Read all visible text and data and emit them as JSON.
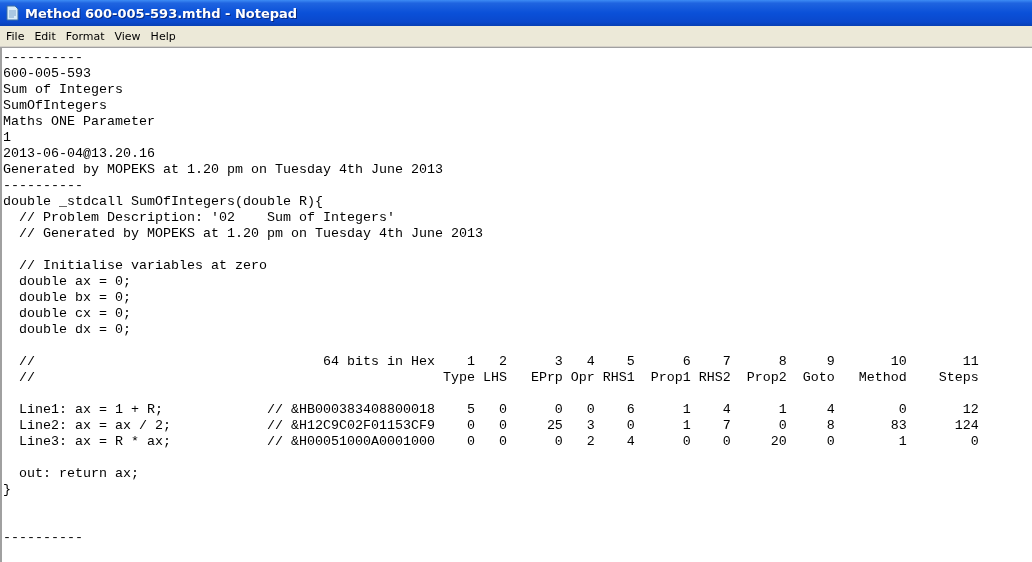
{
  "window": {
    "title": "Method 600-005-593.mthd - Notepad"
  },
  "menu": [
    "File",
    "Edit",
    "Format",
    "View",
    "Help"
  ],
  "editor": {
    "lines": [
      {
        "kind": "text",
        "text": "----------"
      },
      {
        "kind": "text",
        "text": "600-005-593"
      },
      {
        "kind": "text",
        "text": "Sum of Integers"
      },
      {
        "kind": "text",
        "text": "SumOfIntegers"
      },
      {
        "kind": "text",
        "text": "Maths ONE Parameter"
      },
      {
        "kind": "text",
        "text": "1"
      },
      {
        "kind": "text",
        "text": "2013-06-04@13.20.16"
      },
      {
        "kind": "text",
        "text": "Generated by MOPEKS at 1.20 pm on Tuesday 4th June 2013"
      },
      {
        "kind": "text",
        "text": "----------"
      },
      {
        "kind": "text",
        "text": "double _stdcall SumOfIntegers(double R){"
      },
      {
        "kind": "text",
        "text": "  // Problem Description: '02    Sum of Integers'"
      },
      {
        "kind": "text",
        "text": "  // Generated by MOPEKS at 1.20 pm on Tuesday 4th June 2013"
      },
      {
        "kind": "blank"
      },
      {
        "kind": "text",
        "text": "  // Initialise variables at zero"
      },
      {
        "kind": "text",
        "text": "  double ax = 0;"
      },
      {
        "kind": "text",
        "text": "  double bx = 0;"
      },
      {
        "kind": "text",
        "text": "  double cx = 0;"
      },
      {
        "kind": "text",
        "text": "  double dx = 0;"
      },
      {
        "kind": "blank"
      },
      {
        "kind": "text",
        "text": "  //                                    64 bits in Hex    1   2      3   4    5      6    7      8     9       10       11"
      },
      {
        "kind": "text",
        "text": "  //                                                   Type LHS   EPrp Opr RHS1  Prop1 RHS2  Prop2  Goto   Method    Steps"
      },
      {
        "kind": "blank"
      },
      {
        "kind": "text",
        "text": "  Line1: ax = 1 + R;             // &HB000383408800018    5   0      0   0    6      1    4      1     4        0       12"
      },
      {
        "kind": "text",
        "text": "  Line2: ax = ax / 2;            // &H12C9C02F01153CF9    0   0     25   3    0      1    7      0     8       83      124"
      },
      {
        "kind": "text",
        "text": "  Line3: ax = R * ax;            // &H00051000A0001000    0   0      0   2    4      0    0     20     0        1        0"
      },
      {
        "kind": "blank"
      },
      {
        "kind": "text",
        "text": "  out: return ax;"
      },
      {
        "kind": "text",
        "text": "}"
      },
      {
        "kind": "blank"
      },
      {
        "kind": "blank"
      },
      {
        "kind": "text",
        "text": "----------"
      }
    ]
  }
}
